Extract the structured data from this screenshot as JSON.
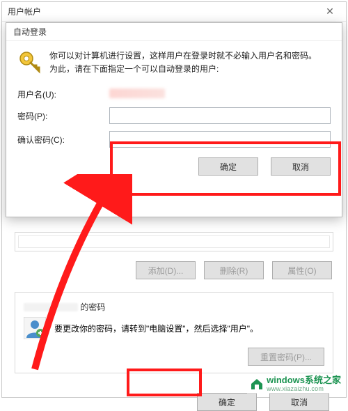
{
  "parent": {
    "title": "用户帐户",
    "buttons": {
      "add": "添加(D)...",
      "remove": "删除(R)",
      "properties": "属性(O)"
    },
    "pw_section": {
      "title_suffix": "的密码",
      "note": "要更改你的密码，请转到\"电脑设置\"，然后选择\"用户\"。",
      "reset": "重置密码(P)..."
    },
    "actions": {
      "ok": "确定",
      "cancel": "取消"
    }
  },
  "child": {
    "title": "自动登录",
    "info_line1": "你可以对计算机进行设置，这样用户在登录时就不必输入用户名和密码。",
    "info_line2": "为此，请在下面指定一个可以自动登录的用户:",
    "fields": {
      "username_label": "用户名(U):",
      "password_label": "密码(P):",
      "confirm_label": "确认密码(C):"
    },
    "actions": {
      "ok": "确定",
      "cancel": "取消"
    }
  },
  "watermark": {
    "line1": "windows系统之家",
    "line2": "www.xiazaizhu.com"
  },
  "colors": {
    "annotation": "#ff1a1a",
    "accent": "#1d9452"
  }
}
